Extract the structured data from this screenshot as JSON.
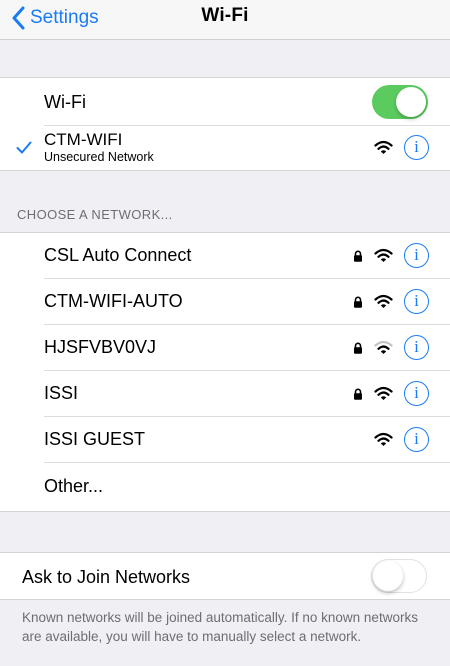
{
  "nav": {
    "back_label": "Settings",
    "title": "Wi-Fi"
  },
  "wifi_toggle": {
    "label": "Wi-Fi",
    "state": "on"
  },
  "connected": {
    "name": "CTM-WIFI",
    "subtitle": "Unsecured Network",
    "info_glyph": "i"
  },
  "choose_header": "CHOOSE A NETWORK...",
  "networks": [
    {
      "name": "CSL Auto Connect",
      "locked": true,
      "signal": "full"
    },
    {
      "name": "CTM-WIFI-AUTO",
      "locked": true,
      "signal": "full"
    },
    {
      "name": "HJSFVBV0VJ",
      "locked": true,
      "signal": "medium"
    },
    {
      "name": "ISSI",
      "locked": true,
      "signal": "full"
    },
    {
      "name": "ISSI GUEST",
      "locked": false,
      "signal": "full"
    }
  ],
  "other_label": "Other...",
  "ask_join": {
    "label": "Ask to Join Networks",
    "state": "off"
  },
  "footer_note": "Known networks will be joined automatically. If no known networks are available, you will have to manually select a network.",
  "colors": {
    "accent": "#1a7cf5",
    "toggle_on": "#5ccb5f",
    "background": "#efeff4"
  },
  "icons": [
    "chevron-left-icon",
    "checkmark-icon",
    "wifi-signal-icon",
    "lock-icon",
    "info-icon"
  ]
}
